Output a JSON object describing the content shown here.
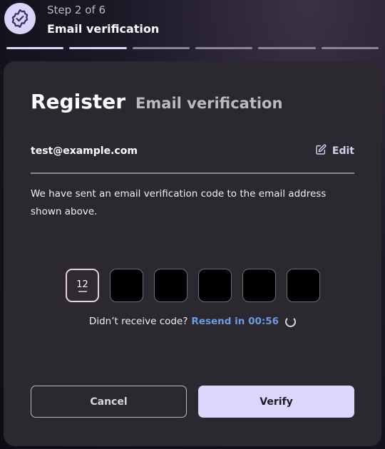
{
  "header": {
    "step_count": "Step 2 of 6",
    "step_title": "Email verification",
    "icon": "badge-check-icon",
    "total_steps": 6,
    "completed_steps": 2
  },
  "card": {
    "title": "Register",
    "subtitle": "Email verification",
    "email": "test@example.com",
    "edit_label": "Edit",
    "description": "We have sent an email verification code to the email address shown above.",
    "code_digits": [
      "12",
      "",
      "",
      "",
      "",
      ""
    ],
    "resend_prompt": "Didn’t receive code?",
    "resend_link": "Resend in 00:56",
    "cancel_label": "Cancel",
    "verify_label": "Verify"
  },
  "colors": {
    "accent": "#ddd5fa",
    "link": "#6b9be6",
    "card_bg": "#2b292f"
  }
}
